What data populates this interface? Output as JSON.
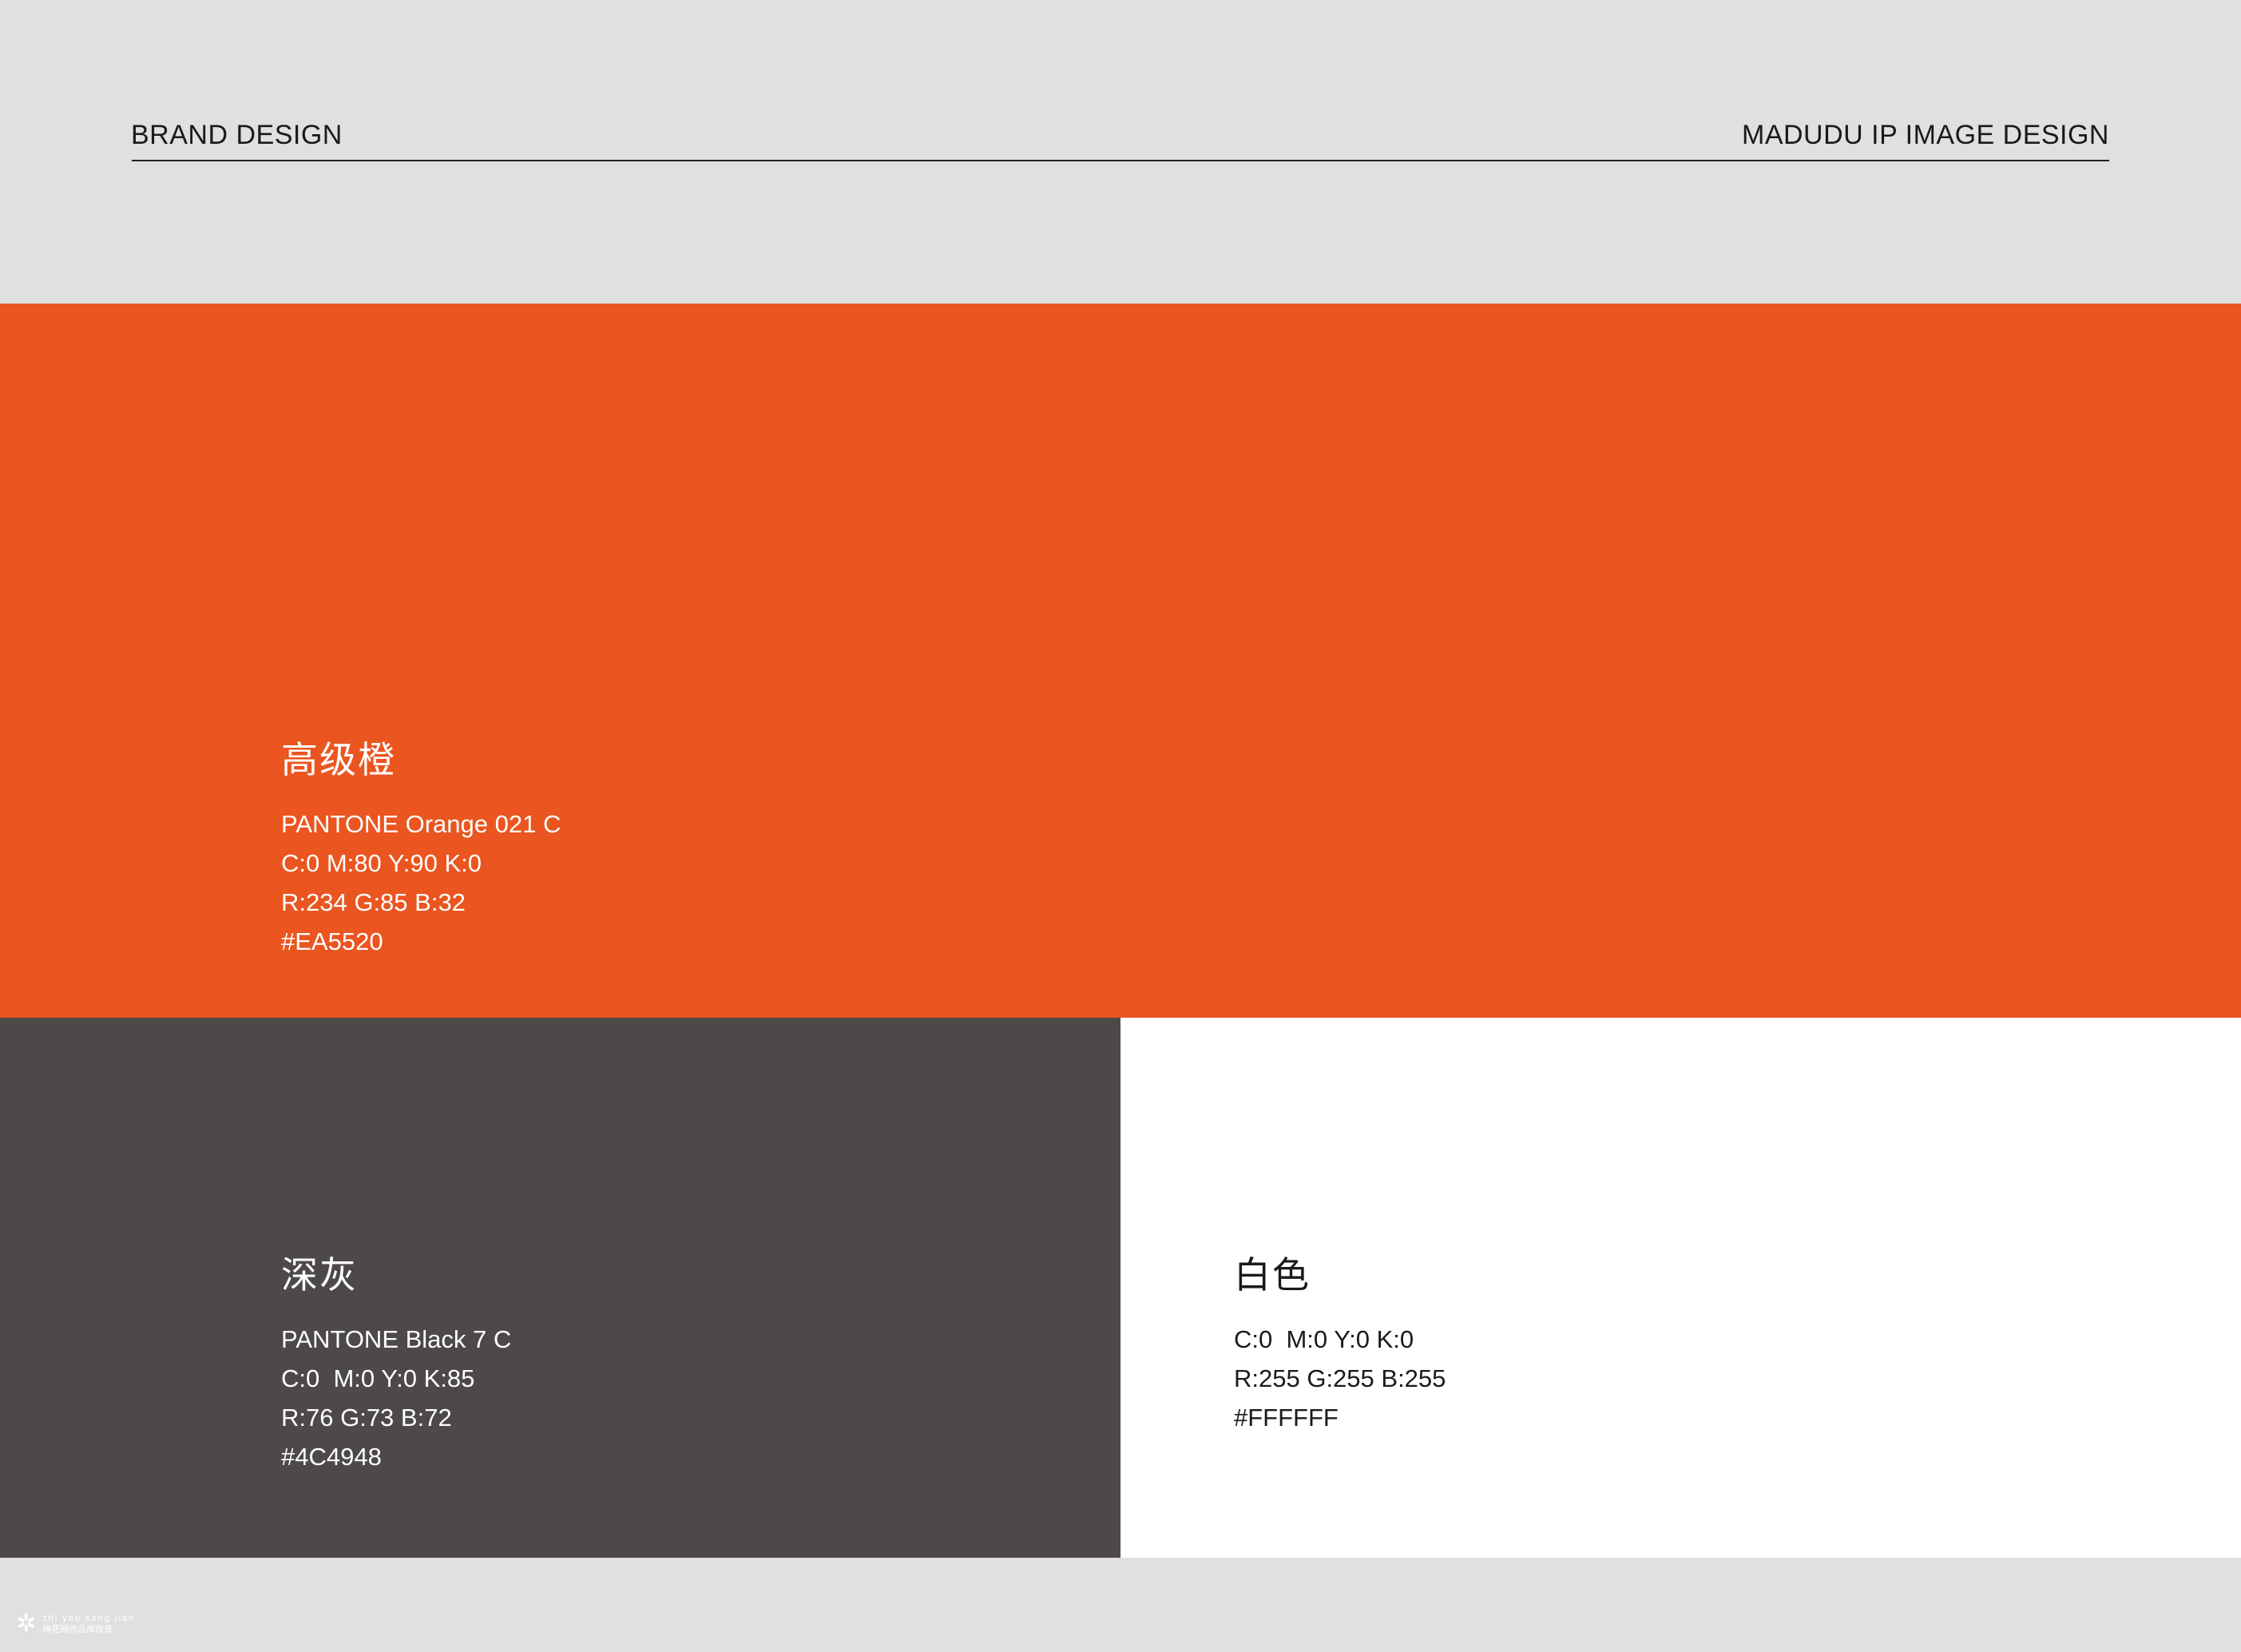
{
  "header": {
    "left_title": "BRAND DESIGN",
    "right_title": "MADUDU IP IMAGE DESIGN"
  },
  "colors": {
    "orange": {
      "name": "高级橙",
      "pantone": "PANTONE Orange 021 C",
      "cmyk": "C:0 M:80 Y:90 K:0",
      "rgb": "R:234 G:85 B:32",
      "hex": "#EA5520",
      "swatch": "#EA5520"
    },
    "gray": {
      "name": "深灰",
      "pantone": "PANTONE Black 7 C",
      "cmyk": "C:0  M:0 Y:0 K:85",
      "rgb": "R:76 G:73 B:72",
      "hex": "#4C4948",
      "swatch": "#4C4948"
    },
    "white": {
      "name": "白色",
      "cmyk": "C:0  M:0 Y:0 K:0",
      "rgb": "R:255 G:255 B:255",
      "hex": "#FFFFFF",
      "swatch": "#FFFFFF"
    }
  },
  "footer": {
    "logo_icon": "flower-logo-icon",
    "watermark_line1": "zhi you kang jian",
    "watermark_line2": "梅花网作品库收录"
  }
}
